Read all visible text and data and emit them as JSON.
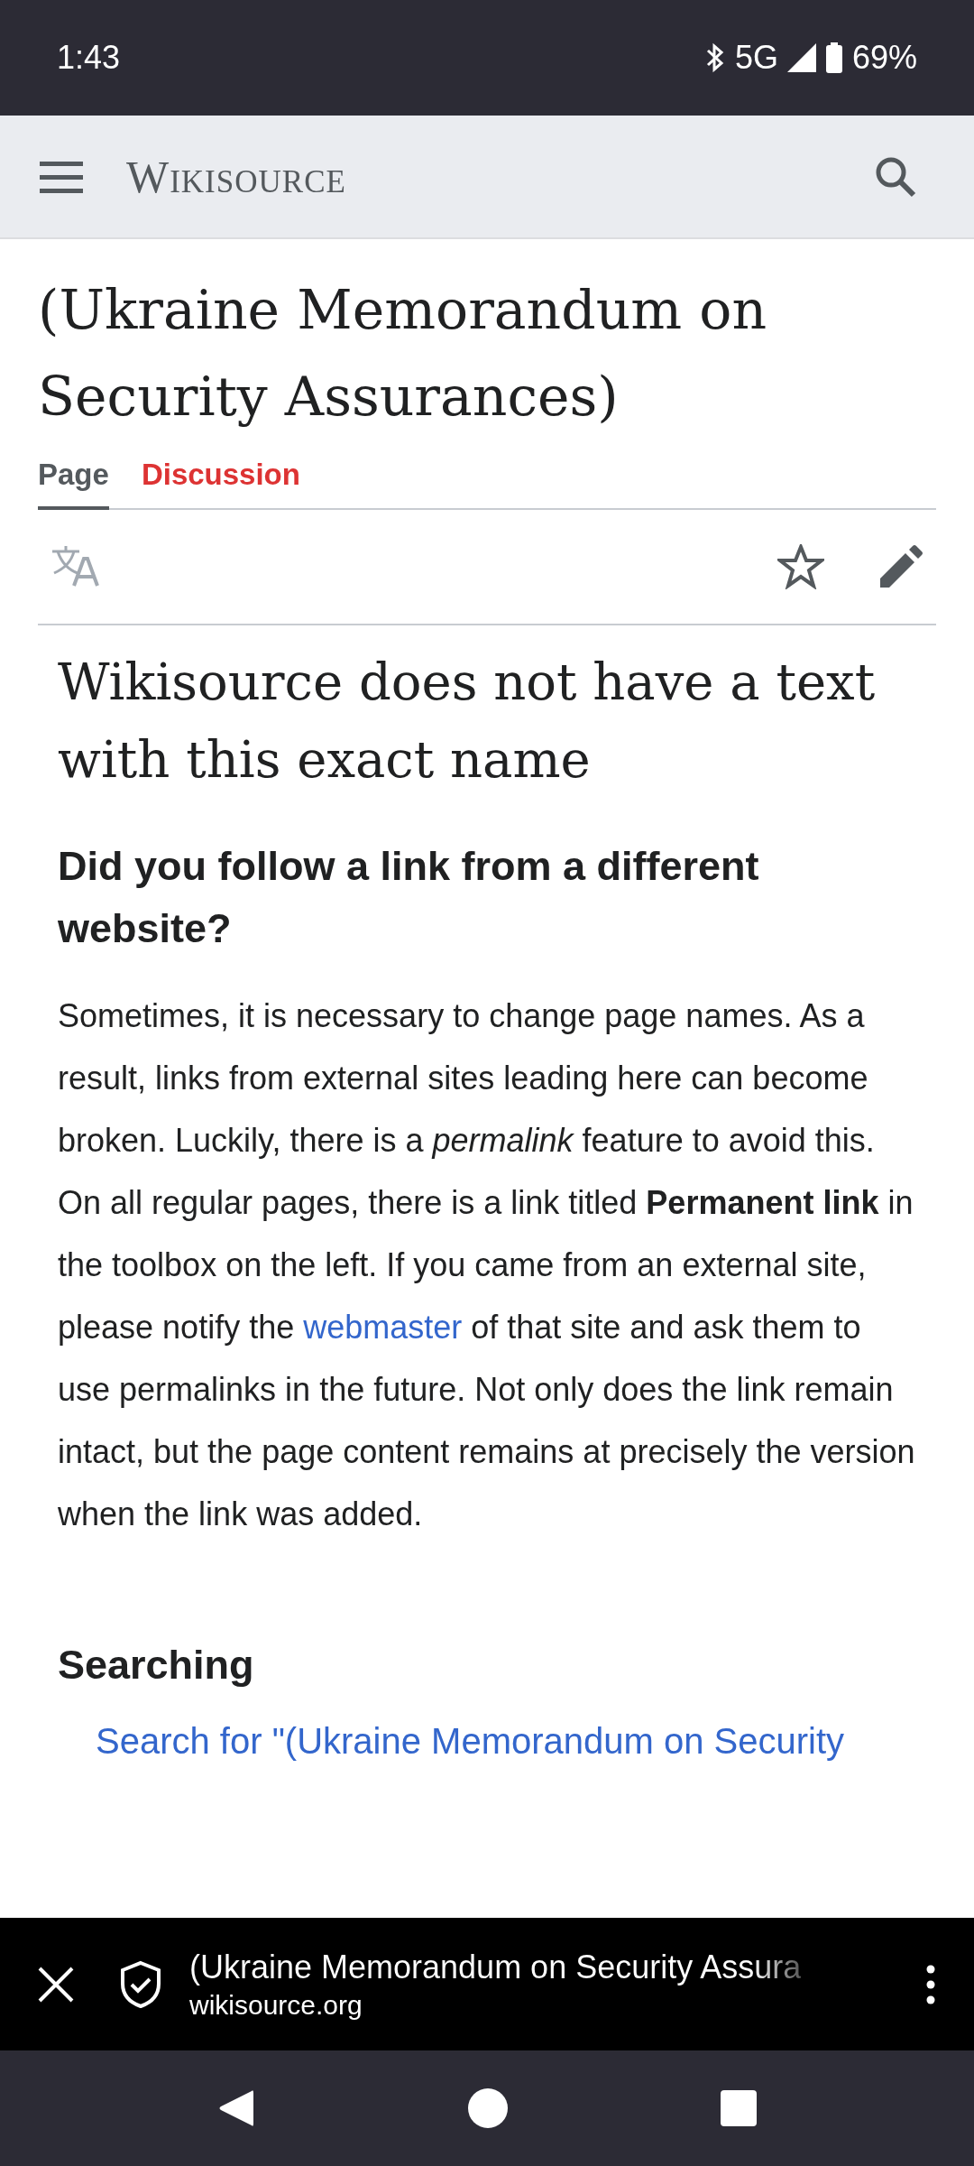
{
  "status_bar": {
    "time": "1:43",
    "network": "5G",
    "battery": "69%"
  },
  "header": {
    "logo": "Wikisource"
  },
  "page": {
    "title": "(Ukraine Memorandum on Security Assurances)",
    "tabs": [
      {
        "label": "Page",
        "selected": true
      },
      {
        "label": "Discussion",
        "selected": false
      }
    ],
    "watch": {
      "starred": false
    }
  },
  "content": {
    "heading": "Wikisource does not have a text with this exact name",
    "subheading": "Did you follow a link from a different website?",
    "paragraph_before_link": "Sometimes, it is necessary to change page names. As a result, links from external sites leading here can become broken. Luckily, there is a *permalink* feature to avoid this. On all regular pages, there is a link titled **Permanent link** in the toolbox on the left. If you came from an external site, please notify the",
    "link": "webmaster",
    "paragraph_after_link": "of that site and ask them to use permalinks in the future. Not only does the link remain intact, but the page content remains at precisely the version when the link was added.",
    "section": "Searching",
    "search_link": "Search for \"(Ukraine Memorandum on Security"
  },
  "browser_bar": {
    "title": "(Ukraine Memorandum on Security Assura",
    "domain": "wikisource.org"
  }
}
